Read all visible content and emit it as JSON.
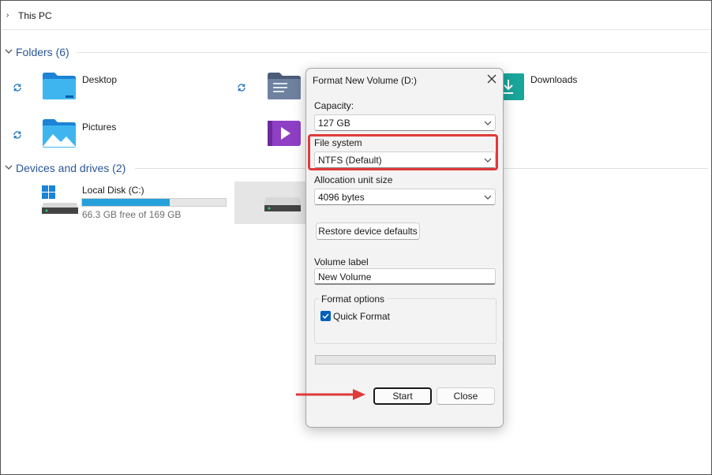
{
  "address_bar": {
    "path": "This PC"
  },
  "folders": {
    "header": "Folders (6)",
    "items": [
      {
        "label": "Desktop"
      },
      {
        "label": "Downloads"
      },
      {
        "label": "Pictures"
      }
    ]
  },
  "devices": {
    "header": "Devices and drives (2)",
    "items": [
      {
        "label": "Local Disk (C:)",
        "free_text": "66.3 GB free of 169 GB",
        "used_fraction": 0.61
      }
    ]
  },
  "dialog": {
    "title": "Format New Volume (D:)",
    "capacity": {
      "label": "Capacity:",
      "value": "127 GB"
    },
    "file_system": {
      "label": "File system",
      "value": "NTFS (Default)"
    },
    "allocation": {
      "label": "Allocation unit size",
      "value": "4096 bytes"
    },
    "restore_button": "Restore device defaults",
    "volume_label": {
      "label": "Volume label",
      "value": "New Volume"
    },
    "format_options": {
      "legend": "Format options",
      "quick_format": {
        "label": "Quick Format",
        "checked": true
      }
    },
    "progress_fraction": 0,
    "start_button": "Start",
    "close_button": "Close"
  },
  "colors": {
    "accent": "#005fb8",
    "annotation": "#e03a3a",
    "drive_fill": "#26a0da"
  }
}
